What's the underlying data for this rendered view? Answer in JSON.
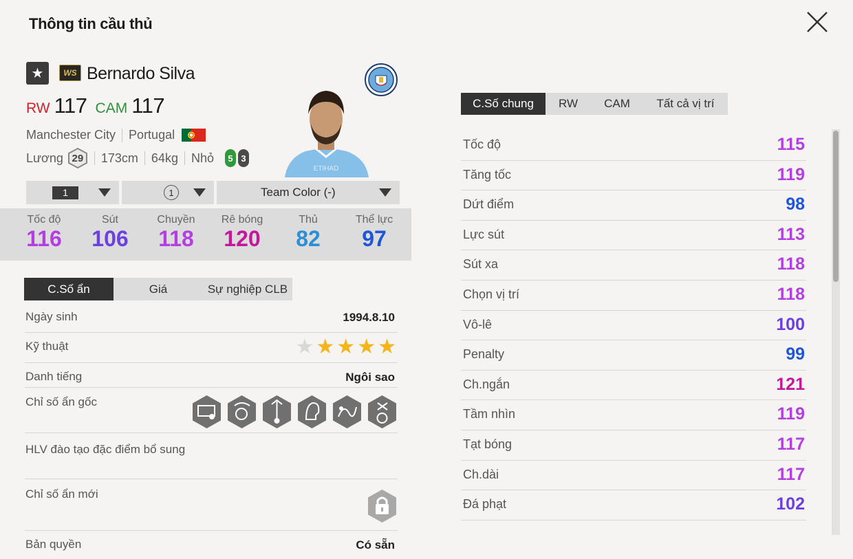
{
  "title": "Thông tin cầu thủ",
  "player": {
    "name": "Bernardo Silva",
    "season_badge": "WS",
    "positions": [
      {
        "pos": "RW",
        "ovr": "117"
      },
      {
        "pos": "CAM",
        "ovr": "117"
      }
    ],
    "club": "Manchester City",
    "nation": "Portugal",
    "salary_label": "Lương",
    "salary": "29",
    "height": "173cm",
    "weight": "64kg",
    "body_type": "Nhỏ",
    "left_foot": "5",
    "right_foot": "3",
    "club_logo_text": "MANCHESTER CITY"
  },
  "selectors": {
    "level": "1",
    "upgrade": "1",
    "team_color": "Team Color (-)"
  },
  "main_stats": [
    {
      "label": "Tốc độ",
      "value": "116",
      "color": "#b43fe0"
    },
    {
      "label": "Sút",
      "value": "106",
      "color": "#6b3fe0"
    },
    {
      "label": "Chuyền",
      "value": "118",
      "color": "#b43fe0"
    },
    {
      "label": "Rê bóng",
      "value": "120",
      "color": "#c4189c"
    },
    {
      "label": "Thủ",
      "value": "82",
      "color": "#2a8fd6"
    },
    {
      "label": "Thể lực",
      "value": "97",
      "color": "#1f56d9"
    }
  ],
  "sub_tabs": [
    "C.Số ẩn",
    "Giá",
    "Sự nghiệp CLB"
  ],
  "info": {
    "birth_label": "Ngày sinh",
    "birth_value": "1994.8.10",
    "skill_label": "Kỹ thuật",
    "skill_stars": 4,
    "fame_label": "Danh tiếng",
    "fame_value": "Ngôi sao",
    "traits_label": "Chỉ số ẩn gốc",
    "coach_label": "HLV đào tạo đặc điểm bổ sung",
    "new_traits_label": "Chỉ số ẩn mới",
    "license_label": "Bản quyền",
    "license_value": "Có sẵn"
  },
  "right_tabs": [
    "C.Số chung",
    "RW",
    "CAM",
    "Tất cả vị trí"
  ],
  "attributes": [
    {
      "name": "Tốc độ",
      "value": "115",
      "color": "#b43fe0"
    },
    {
      "name": "Tăng tốc",
      "value": "119",
      "color": "#b43fe0"
    },
    {
      "name": "Dứt điểm",
      "value": "98",
      "color": "#1f56d9"
    },
    {
      "name": "Lực sút",
      "value": "113",
      "color": "#b43fe0"
    },
    {
      "name": "Sút xa",
      "value": "118",
      "color": "#b43fe0"
    },
    {
      "name": "Chọn vị trí",
      "value": "118",
      "color": "#b43fe0"
    },
    {
      "name": "Vô-lê",
      "value": "100",
      "color": "#6b3fe0"
    },
    {
      "name": "Penalty",
      "value": "99",
      "color": "#1f56d9"
    },
    {
      "name": "Ch.ngắn",
      "value": "121",
      "color": "#c4189c"
    },
    {
      "name": "Tầm nhìn",
      "value": "119",
      "color": "#b43fe0"
    },
    {
      "name": "Tạt bóng",
      "value": "117",
      "color": "#b43fe0"
    },
    {
      "name": "Ch.dài",
      "value": "117",
      "color": "#b43fe0"
    },
    {
      "name": "Đá phạt",
      "value": "102",
      "color": "#6b3fe0"
    }
  ]
}
